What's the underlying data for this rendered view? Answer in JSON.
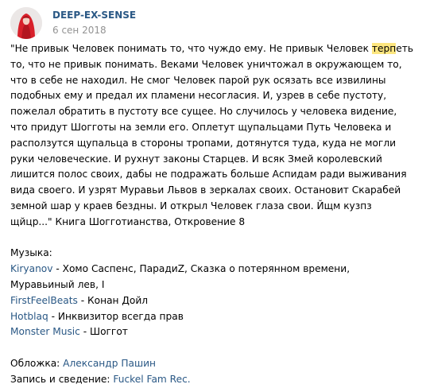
{
  "post": {
    "author": "DEEP-EX-SENSE",
    "date": "6 сен 2018",
    "quote": {
      "before": "\"Не привык Человек понимать то, что чуждо ему. Не привык Человек ",
      "highlight": "терп",
      "after": "еть то, что не привык понимать. Веками Человек уничтожал в окружающем то, что в себе не находил. Не смог Человек парой рук осязать все извилины подобных ему и предал их пламени несогласия. И, узрев в себе пустоту, пожелал обратить в пустоту все сущее. Но случилось у человека видение, что придут Шогготы на земли его. Оплетут щупальцами Путь Человека и расползутся щупальца в стороны тропами, дотянутся туда, куда не могли руки человеческие. И рухнут законы Старцев. И всяк Змей королевский лишится полос своих, дабы не подражать больше Аспидам ради выживания вида своего. И узрят Муравьи Львов в зеркалах своих. Остановит Скарабей земной шар у краев бездны. И открыл Человек глаза свои. Йщм кузпз щйцр...\" Книга Шогготианства, Откровение 8"
    },
    "music_label": "Музыка:",
    "music": [
      {
        "artist": "Kiryanov",
        "tracks": " - Хомо Саспенс, ПарадиZ, Сказка о потерянном времени, Муравьиный лев, I"
      },
      {
        "artist": "FirstFeelBeats",
        "tracks": " - Конан Дойл"
      },
      {
        "artist": "Hotblaq",
        "tracks": " - Инквизитор всегда прав"
      },
      {
        "artist": "Monster Music",
        "tracks": " - Шоггот"
      }
    ],
    "cover": {
      "label": "Обложка: ",
      "name": "Александр Пашин"
    },
    "mixing": {
      "label": "Запись и сведение: ",
      "name": "Fuckel Fam Rec."
    }
  },
  "colors": {
    "link": "#2a5885",
    "date": "#939393",
    "highlight": "#fde67f"
  },
  "icons": {
    "avatar": "avatar-red-hooded-figure"
  }
}
